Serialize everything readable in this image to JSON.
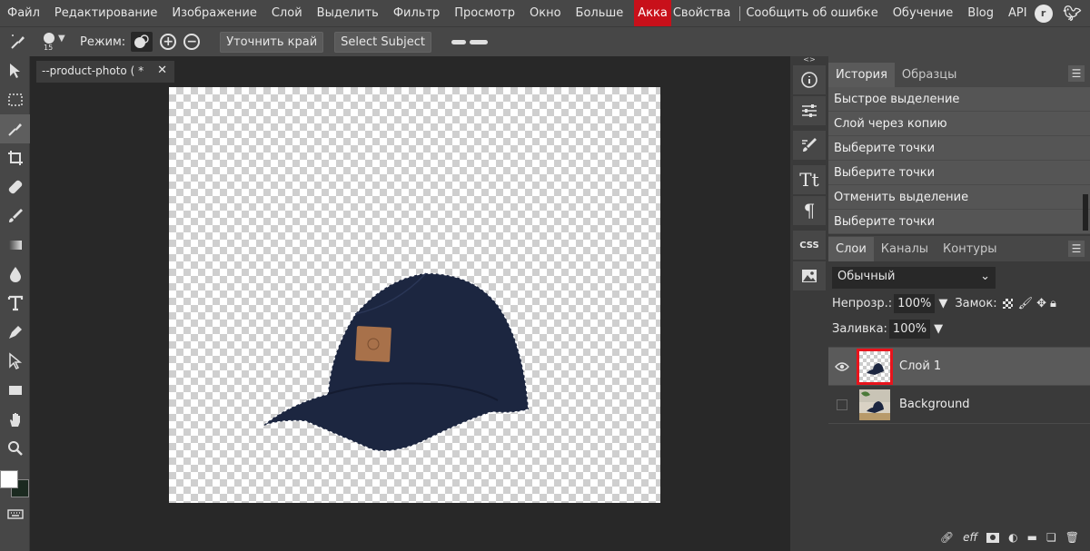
{
  "menu": {
    "items": [
      "Файл",
      "Редактирование",
      "Изображение",
      "Слой",
      "Выделить",
      "Фильтр",
      "Просмотр",
      "Окно",
      "Больше"
    ],
    "account": "Акка",
    "properties": "Свойства",
    "report": "Сообщить об ошибке",
    "learn": "Обучение",
    "blog": "Blog",
    "api": "API",
    "social_icons": [
      "reddit-icon",
      "twitter-icon",
      "facebook-icon"
    ]
  },
  "options": {
    "brush_size": "15",
    "mode_label": "Режим:",
    "refine_edge": "Уточнить край",
    "select_subject": "Select Subject"
  },
  "document": {
    "tab_title": "--product-photo (",
    "modified": "*",
    "close": "✕"
  },
  "history": {
    "tabs": [
      "История",
      "Образцы"
    ],
    "items": [
      "Быстрое выделение",
      "Слой через копию",
      "Выберите точки",
      "Выберите точки",
      "Отменить выделение",
      "Выберите точки"
    ]
  },
  "layers": {
    "tabs": [
      "Слои",
      "Каналы",
      "Контуры"
    ],
    "blend_mode": "Обычный",
    "opacity_label": "Непрозр.:",
    "opacity_value": "100%",
    "lock_label": "Замок:",
    "fill_label": "Заливка:",
    "fill_value": "100%",
    "items": [
      {
        "name": "Слой 1",
        "visible": true,
        "selected": true
      },
      {
        "name": "Background",
        "visible": false,
        "selected": false
      }
    ],
    "bottom_icons": [
      "link-icon",
      "effects-icon",
      "mask-icon",
      "adjustment-icon",
      "folder-icon",
      "new-layer-icon",
      "trash-icon"
    ],
    "effects_label": "eff"
  },
  "colors": {
    "accent_red": "#c8101a",
    "cap_navy": "#1c2640",
    "patch": "#a8714a"
  }
}
